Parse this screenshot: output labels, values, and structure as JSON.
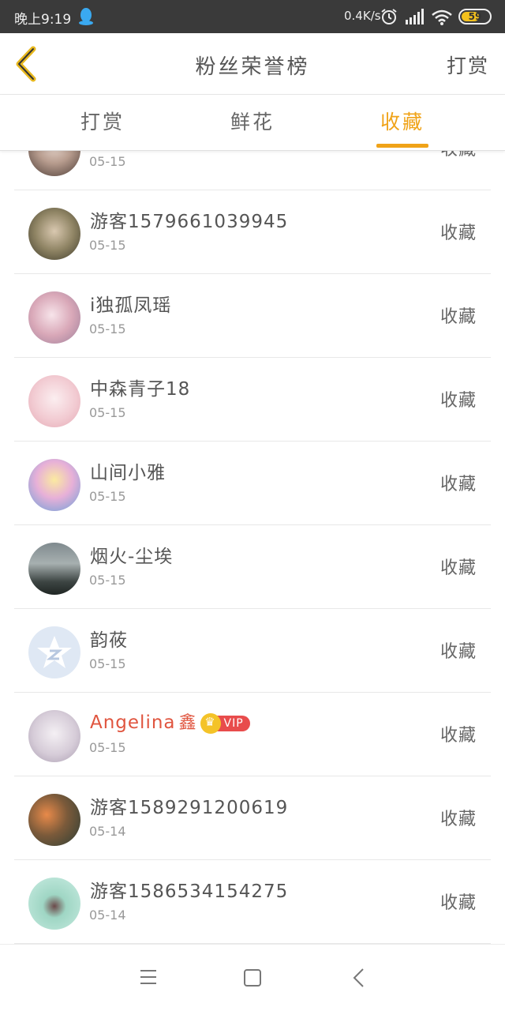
{
  "status_bar": {
    "time": "晚上9:19",
    "net_speed": "0.4K/s",
    "battery": "59",
    "icons": [
      "qq-icon",
      "alarm-icon",
      "signal-icon",
      "wifi-icon",
      "battery-icon"
    ]
  },
  "header": {
    "title": "粉丝荣誉榜",
    "right_action": "打赏",
    "back_icon": "chevron-left-icon",
    "accent_color": "#f0a318"
  },
  "tabs": [
    {
      "label": "打赏",
      "active": false
    },
    {
      "label": "鲜花",
      "active": false
    },
    {
      "label": "收藏",
      "active": true
    }
  ],
  "list": [
    {
      "name": "",
      "date": "05-15",
      "action": "收藏"
    },
    {
      "name": "游客1579661039945",
      "date": "05-15",
      "action": "收藏"
    },
    {
      "name": "i独孤凤瑶",
      "date": "05-15",
      "action": "收藏"
    },
    {
      "name": "中森青子18",
      "date": "05-15",
      "action": "收藏"
    },
    {
      "name": "山间小雅",
      "date": "05-15",
      "action": "收藏"
    },
    {
      "name": "烟火-尘埃",
      "date": "05-15",
      "action": "收藏"
    },
    {
      "name": "韵莜",
      "date": "05-15",
      "action": "收藏"
    },
    {
      "name": "Angelina",
      "suffix": "鑫",
      "badge": "VIP",
      "date": "05-15",
      "action": "收藏"
    },
    {
      "name": "游客1589291200619",
      "date": "05-14",
      "action": "收藏"
    },
    {
      "name": "游客1586534154275",
      "date": "05-14",
      "action": "收藏"
    }
  ],
  "nav_bar": {
    "icons": [
      "menu-icon",
      "home-square-icon",
      "back-triangle-icon"
    ]
  }
}
